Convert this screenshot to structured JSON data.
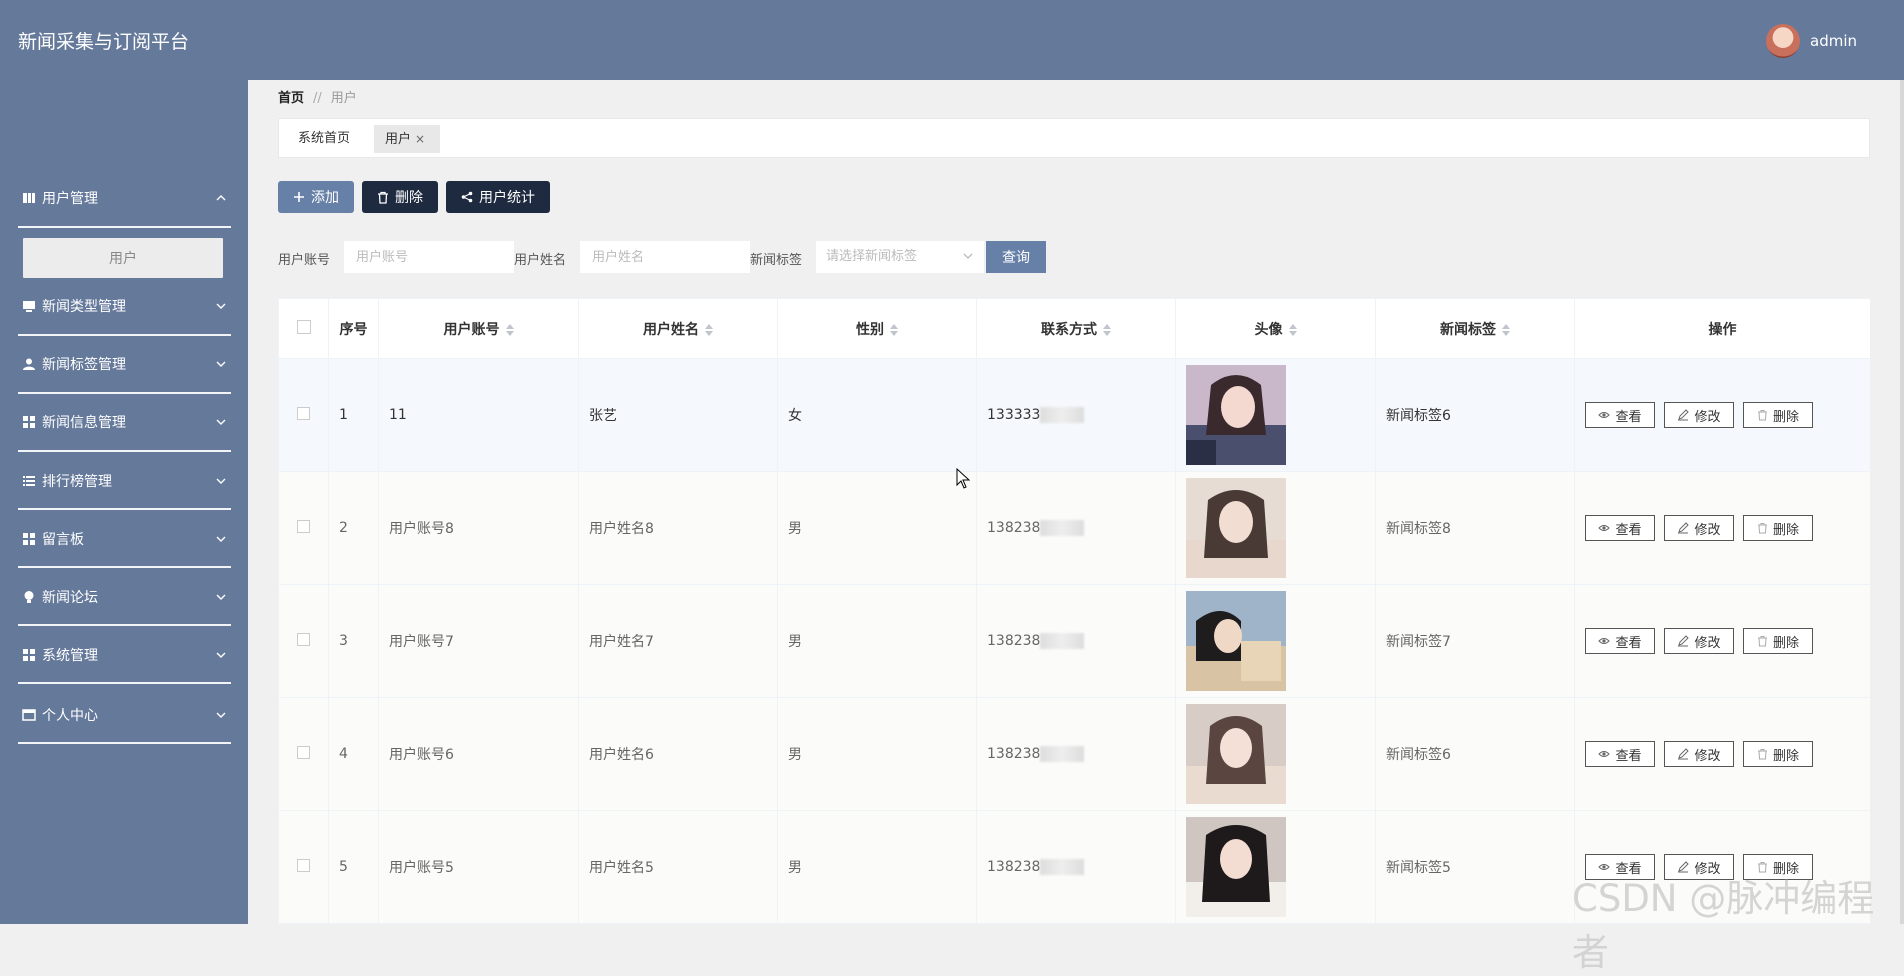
{
  "app": {
    "title": "新闻采集与订阅平台",
    "username": "admin"
  },
  "sidebar": {
    "items": [
      {
        "label": "用户管理",
        "icon": "book-icon",
        "expanded": true
      },
      {
        "label": "新闻类型管理",
        "icon": "monitor-icon"
      },
      {
        "label": "新闻标签管理",
        "icon": "person-icon"
      },
      {
        "label": "新闻信息管理",
        "icon": "grid-icon"
      },
      {
        "label": "排行榜管理",
        "icon": "list-icon"
      },
      {
        "label": "留言板",
        "icon": "grid-icon"
      },
      {
        "label": "新闻论坛",
        "icon": "bulb-icon"
      },
      {
        "label": "系统管理",
        "icon": "grid-icon"
      },
      {
        "label": "个人中心",
        "icon": "window-icon"
      }
    ],
    "active_sub": "用户"
  },
  "breadcrumb": {
    "home": "首页",
    "separator": "//",
    "current": "用户"
  },
  "tabs": {
    "home": "系统首页",
    "current": "用户",
    "close": "×"
  },
  "toolbar": {
    "add": "添加",
    "delete": "删除",
    "stats": "用户统计"
  },
  "search": {
    "account_label": "用户账号",
    "account_placeholder": "用户账号",
    "name_label": "用户姓名",
    "name_placeholder": "用户姓名",
    "tag_label": "新闻标签",
    "tag_placeholder": "请选择新闻标签",
    "query": "查询"
  },
  "table": {
    "headers": {
      "index": "序号",
      "account": "用户账号",
      "name": "用户姓名",
      "gender": "性别",
      "phone": "联系方式",
      "avatar": "头像",
      "tag": "新闻标签",
      "ops": "操作"
    },
    "actions": {
      "view": "查看",
      "edit": "修改",
      "delete": "删除"
    },
    "rows": [
      {
        "index": "1",
        "account": "11",
        "name": "张艺",
        "gender": "女",
        "phone": "133333",
        "tag": "新闻标签6"
      },
      {
        "index": "2",
        "account": "用户账号8",
        "name": "用户姓名8",
        "gender": "男",
        "phone": "138238",
        "tag": "新闻标签8"
      },
      {
        "index": "3",
        "account": "用户账号7",
        "name": "用户姓名7",
        "gender": "男",
        "phone": "138238",
        "tag": "新闻标签7"
      },
      {
        "index": "4",
        "account": "用户账号6",
        "name": "用户姓名6",
        "gender": "男",
        "phone": "138238",
        "tag": "新闻标签6"
      },
      {
        "index": "5",
        "account": "用户账号5",
        "name": "用户姓名5",
        "gender": "男",
        "phone": "138238",
        "tag": "新闻标签5"
      }
    ]
  },
  "watermark": "CSDN @脉冲编程者",
  "colors": {
    "primary": "#65799b",
    "dark_button": "#1e2a40",
    "accent_button": "#6680a8"
  }
}
